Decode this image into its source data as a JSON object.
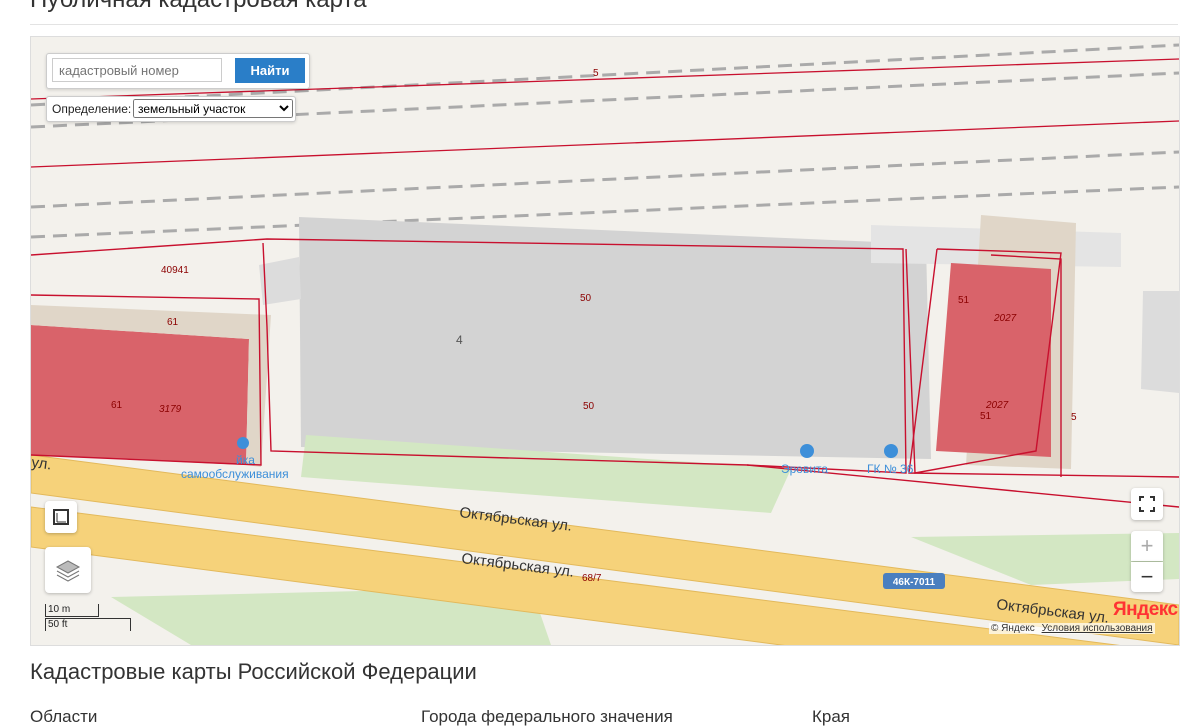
{
  "header": {
    "title": "Публичная кадастровая карта"
  },
  "search": {
    "placeholder": "кадастровый номер",
    "button_label": "Найти"
  },
  "definition": {
    "label": "Определение:",
    "selected": "земельный участок"
  },
  "map": {
    "parcel_labels": [
      "5",
      "40941",
      "61",
      "50",
      "4",
      "50",
      "51",
      "2027",
      "2027",
      "51",
      "5",
      "61",
      "3179"
    ],
    "street_labels": [
      "Октябрьская ул.",
      "Октябрьская ул.",
      "Октябрьская ул.",
      "ул."
    ],
    "road_badge": "46К-7011",
    "house_number": "68/7",
    "pois": [
      "Эровита",
      "ГК № 36",
      "самообслуживания",
      "йка"
    ],
    "scale_metric": "10 m",
    "scale_imperial": "50 ft",
    "brand": "Яндекс",
    "copyright": "© Яндекс",
    "terms": "Условия использования",
    "colors": {
      "parcel_border": "#c8102e",
      "building": "#d9636a",
      "road": "#f6d27a",
      "poi": "#3d8fd9"
    }
  },
  "controls": {
    "zoom_in": "+",
    "zoom_out": "−"
  },
  "footer": {
    "title": "Кадастровые карты Российской Федерации",
    "columns": [
      "Области",
      "Города федерального значения",
      "Края"
    ]
  }
}
